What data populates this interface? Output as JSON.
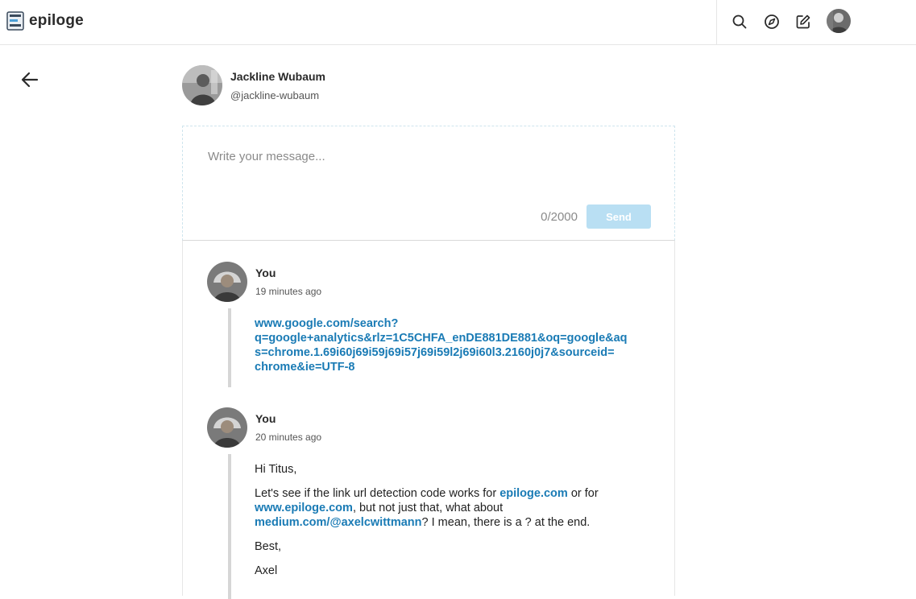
{
  "brand": {
    "name": "epiloge",
    "logo_icon": "epiloge-logo-icon"
  },
  "nav": {
    "search_icon": "search-icon",
    "explore_icon": "compass-icon",
    "write_icon": "edit-icon",
    "avatar": "user-avatar"
  },
  "conversation": {
    "name": "Jackline Wubaum",
    "handle": "@jackline-wubaum"
  },
  "composer": {
    "placeholder": "Write your message...",
    "counter": "0/2000",
    "send_label": "Send"
  },
  "messages": [
    {
      "author": "You",
      "time": "19 minutes ago",
      "link_lines": [
        "www.google.com/search?",
        "q=google+analytics&rlz=1C5CHFA_enDE881DE881&oq=google&aq",
        "s=chrome.1.69i60j69i59j69i57j69i59l2j69i60l3.2160j0j7&sourceid=",
        "chrome&ie=UTF-8"
      ]
    },
    {
      "author": "You",
      "time": "20 minutes ago",
      "greeting": "Hi Titus,",
      "body": {
        "t1": "Let's see if the link url detection code works for ",
        "link1": "epiloge.com",
        "t2": " or for",
        "link2": "www.epiloge.com",
        "t3": ", but not just that, what about",
        "link3": "medium.com/@axelcwittmann",
        "t4": "? I mean, there is a ? at the end."
      },
      "signoff": "Best,",
      "signature": "Axel"
    }
  ],
  "colors": {
    "accent_link": "#1a7bb5",
    "send_disabled": "#b9dff3",
    "quote_bar": "#d6d6d6"
  }
}
